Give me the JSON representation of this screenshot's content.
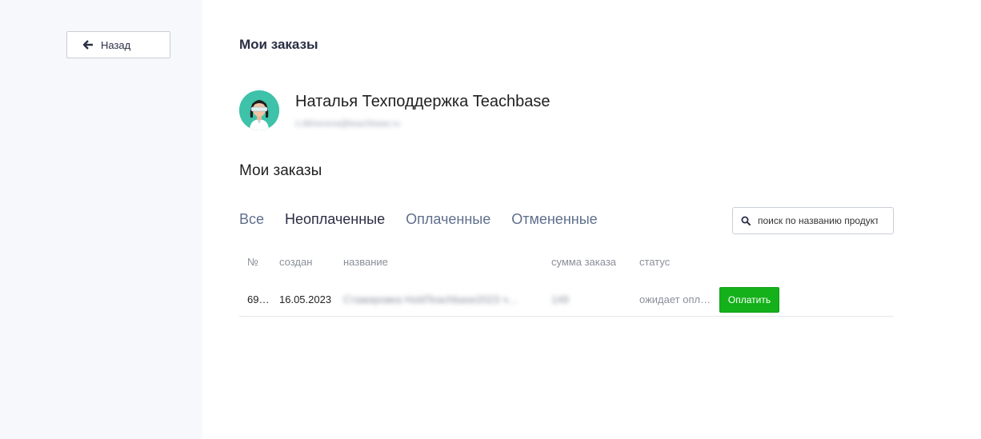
{
  "back_button": {
    "label": "Назад"
  },
  "page": {
    "title": "Мои заказы"
  },
  "user": {
    "name": "Наталья Техподдержка Teachbase",
    "email": "n.tikhonova@teachbase.ru"
  },
  "orders": {
    "title": "Мои заказы",
    "tabs": [
      {
        "label": "Все",
        "active": false
      },
      {
        "label": "Неоплаченные",
        "active": true
      },
      {
        "label": "Оплаченные",
        "active": false
      },
      {
        "label": "Отмененные",
        "active": false
      }
    ],
    "search": {
      "placeholder": "поиск по названию продукта",
      "icon": "search-icon"
    },
    "columns": {
      "number": "№",
      "created": "создан",
      "name": "название",
      "amount": "сумма заказа",
      "status": "статус"
    },
    "rows": [
      {
        "number": "69…",
        "created": "16.05.2023",
        "name": "Стажировка HoldTeachbase2023 ч…",
        "amount": "149",
        "status": "ожидает опл…",
        "action": "Оплатить"
      }
    ]
  },
  "colors": {
    "accent_green": "#14b11a",
    "sidebar_bg": "#f7f8fb",
    "avatar_bg": "#3ec2a9"
  }
}
